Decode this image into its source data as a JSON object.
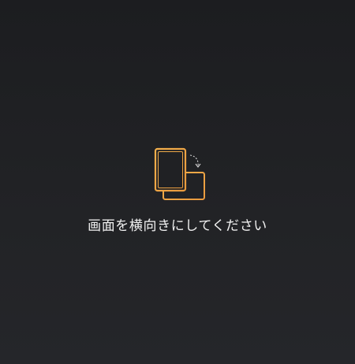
{
  "overlay": {
    "icon": "rotate-device-icon",
    "accent_color": "#f0b04a",
    "message": "画面を横向きにしてください"
  }
}
